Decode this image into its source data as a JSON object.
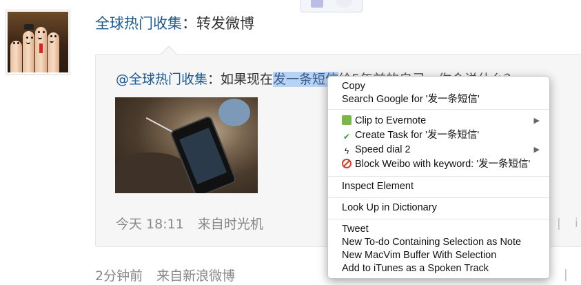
{
  "post": {
    "author": "全球热门收集",
    "separator": "：",
    "action": "转发微博"
  },
  "forward": {
    "at_author": "@全球热门收集",
    "separator": "：",
    "text_before": "如果现在",
    "selected": "发一条短信",
    "text_after": "给5年前的自己，你会说什么？",
    "time": "今天 18:11",
    "source_prefix": "来自",
    "source": "时光机"
  },
  "footer": {
    "time": "2分钟前",
    "source_prefix": "来自",
    "source": "新浪微博"
  },
  "context_menu": {
    "copy": "Copy",
    "search_google": "Search Google for '发一条短信'",
    "clip_evernote": "Clip to Evernote",
    "create_task": "Create Task for '发一条短信'",
    "speed_dial": "Speed dial 2",
    "block_weibo": "Block Weibo with keyword: '发一条短信'",
    "inspect": "Inspect Element",
    "look_up": "Look Up in Dictionary",
    "tweet": "Tweet",
    "new_todo": "New To-do Containing Selection as Note",
    "new_macvim": "New MacVim Buffer With Selection",
    "add_itunes": "Add to iTunes as a Spoken Track"
  },
  "icons": {
    "evernote": "evernote-icon",
    "task": "checkmark-icon",
    "speed_dial": "lightning-icon",
    "block": "block-icon",
    "submenu": "submenu-arrow-icon"
  },
  "colors": {
    "link": "#1b5a96",
    "selection": "#b6d2f5",
    "meta": "#888888"
  }
}
